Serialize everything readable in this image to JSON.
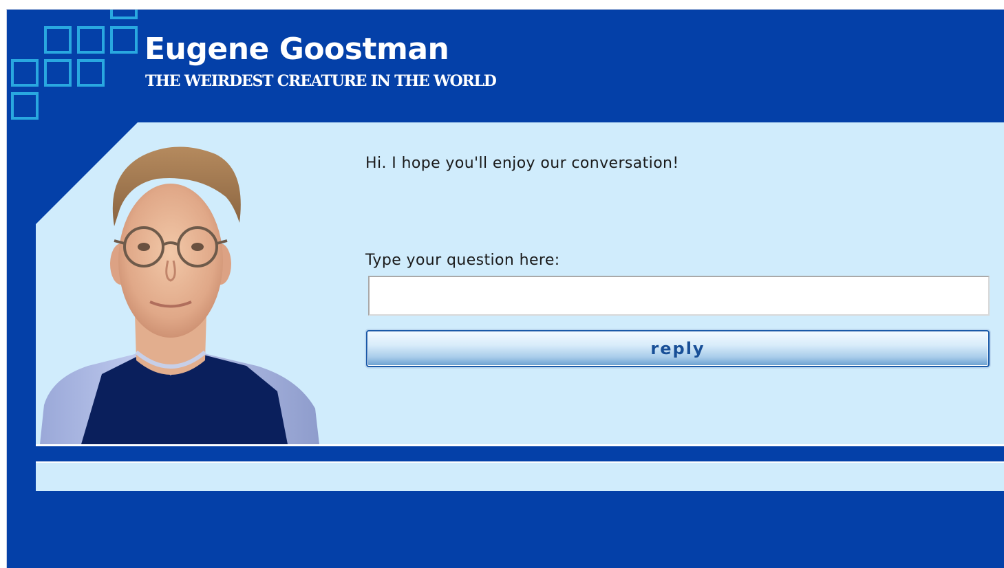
{
  "header": {
    "title": "Eugene Goostman",
    "subtitle": "THE WEIRDEST CREATURE IN THE WORLD"
  },
  "chat": {
    "bot_message": "Hi. I hope you'll enjoy our conversation!",
    "input_label": "Type your question here:",
    "input_value": "",
    "reply_label": "reply"
  },
  "icons": {
    "logo": "squares-logo-icon",
    "avatar": "bot-avatar"
  },
  "colors": {
    "frame_blue": "#0440a8",
    "panel_light_blue": "#d0ecfc",
    "logo_cyan": "#29a8e0",
    "button_text": "#184f97"
  }
}
